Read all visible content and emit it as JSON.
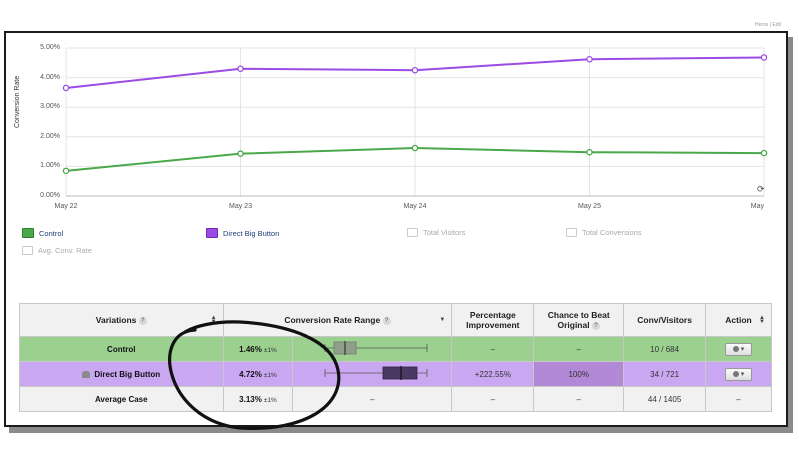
{
  "corner_text": "Heros | Edit",
  "chart_data": {
    "type": "line",
    "ylabel": "Conversion Rate",
    "xlabel": "",
    "x": [
      "May 22",
      "May 23",
      "May 24",
      "May 25",
      "May"
    ],
    "ylim": [
      0,
      5
    ],
    "yticks": [
      "0.00%",
      "1.00%",
      "2.00%",
      "3.00%",
      "4.00%",
      "5.00%"
    ],
    "grid": true,
    "legend_position": "bottom",
    "series": [
      {
        "name": "Control",
        "values": [
          0.85,
          1.43,
          1.62,
          1.48,
          1.45
        ],
        "color": "#4aa84a"
      },
      {
        "name": "Direct Big Button",
        "values": [
          3.65,
          4.3,
          4.25,
          4.62,
          4.68
        ],
        "color": "#9b4be3"
      }
    ]
  },
  "legend": {
    "items": [
      {
        "label": "Control",
        "color": "#4aa84a",
        "active": true
      },
      {
        "label": "Direct Big Button",
        "color": "#9b4be3",
        "active": true
      },
      {
        "label": "Total Visitors",
        "active": false
      },
      {
        "label": "Total Conversions",
        "active": false
      },
      {
        "label": "Avg. Conv. Rate",
        "active": false
      }
    ]
  },
  "table": {
    "headers": {
      "variations": "Variations",
      "range": "Conversion Rate Range",
      "improvement_1": "Percentage",
      "improvement_2": "Improvement",
      "chance_1": "Chance to Beat",
      "chance_2": "Original",
      "conv": "Conv/Visitors",
      "action": "Action"
    },
    "rows": [
      {
        "name": "Control",
        "rate": "1.46%",
        "pm": "±1%",
        "improvement": "–",
        "chance": "–",
        "conv": "10 / 684",
        "range_center": 1.46,
        "range_error": 1.0
      },
      {
        "name": "Direct Big Button",
        "rate": "4.72%",
        "pm": "±1%",
        "improvement": "+222.55%",
        "chance": "100%",
        "conv": "34 / 721",
        "range_center": 4.72,
        "range_error": 1.0
      },
      {
        "name": "Average Case",
        "rate": "3.13%",
        "pm": "±1%",
        "range_text": "–",
        "improvement": "–",
        "chance": "–",
        "conv": "44 / 1405",
        "action": "–"
      }
    ]
  }
}
